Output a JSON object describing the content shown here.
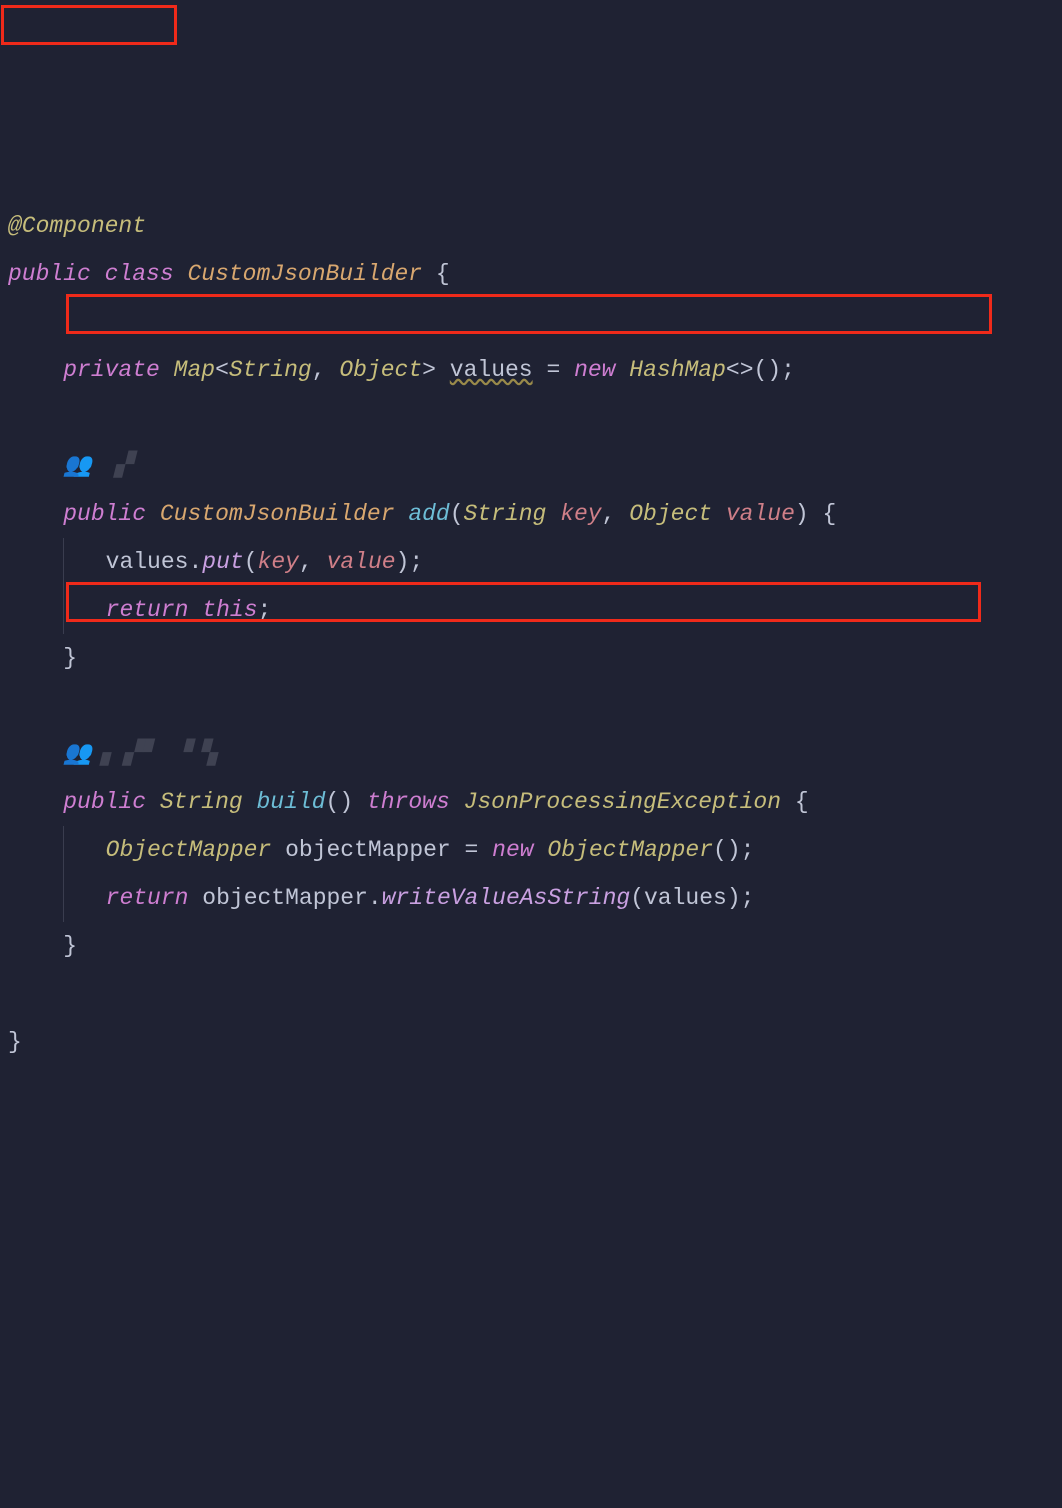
{
  "code": {
    "annotation": "@Component",
    "kw_public": "public",
    "kw_class": "class",
    "class_name": "CustomJsonBuilder",
    "brace_open": "{",
    "brace_close": "}",
    "kw_private": "private",
    "type_map": "Map",
    "lt": "<",
    "type_string": "String",
    "comma": ",",
    "type_object": "Object",
    "gt": ">",
    "field_values": "values",
    "eq": "=",
    "kw_new": "new",
    "type_hashmap": "HashMap",
    "diamond": "<>",
    "paren_empty": "()",
    "semi": ";",
    "method_add": "add",
    "param_key": "key",
    "param_value": "value",
    "dot": ".",
    "call_put": "put",
    "kw_return": "return",
    "kw_this": "this",
    "method_build": "build",
    "kw_throws": "throws",
    "type_exception": "JsonProcessingException",
    "type_om": "ObjectMapper",
    "var_om": "objectMapper",
    "call_write": "writeValueAsString",
    "paren_open": "(",
    "paren_close": ")"
  }
}
